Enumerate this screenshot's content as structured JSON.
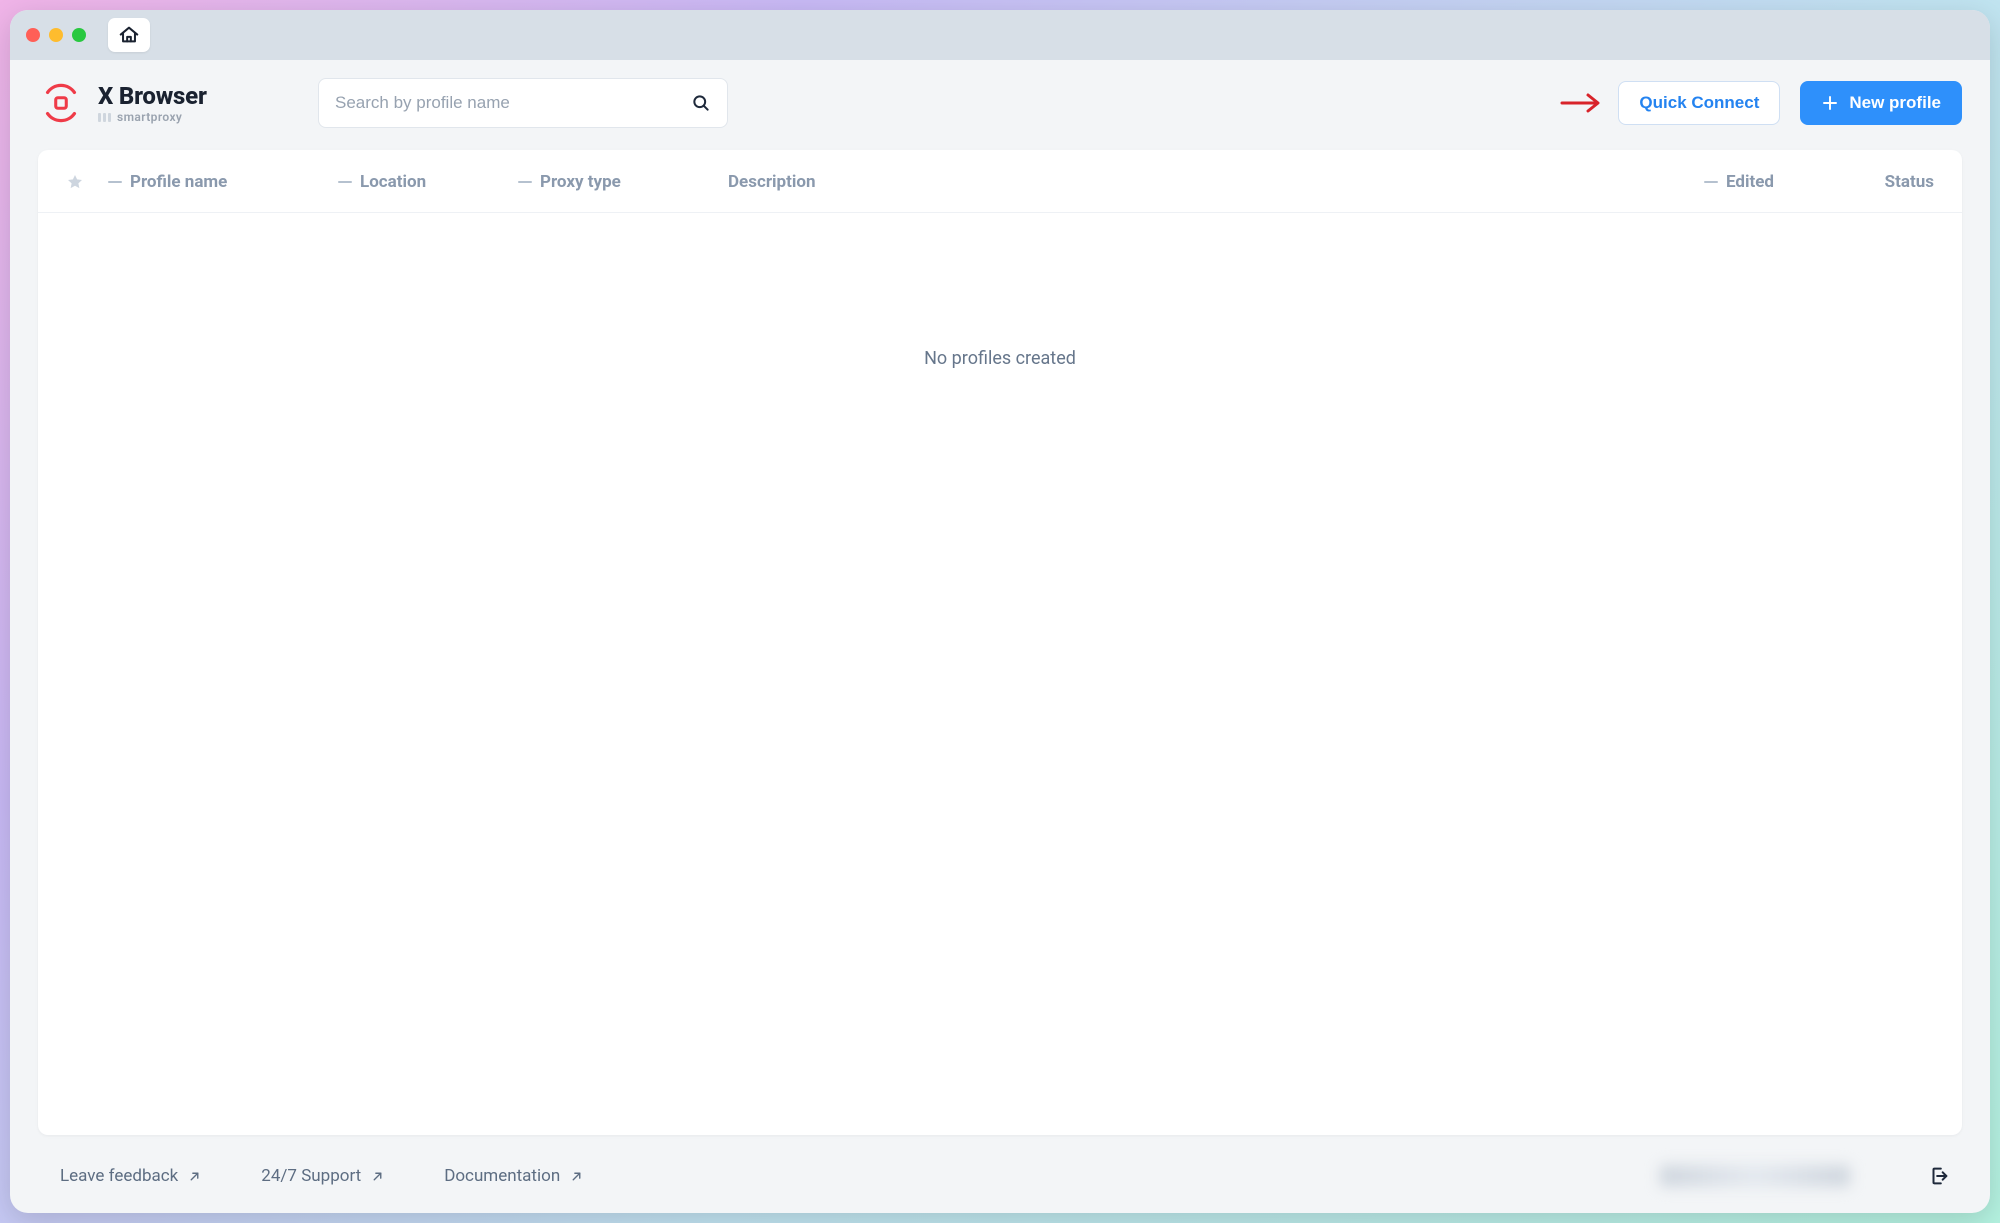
{
  "brand": {
    "title": "X Browser",
    "subtitle": "smartproxy"
  },
  "search": {
    "placeholder": "Search by profile name",
    "value": ""
  },
  "actions": {
    "quick_connect": "Quick Connect",
    "new_profile": "New profile"
  },
  "columns": {
    "profile_name": "Profile name",
    "location": "Location",
    "proxy_type": "Proxy type",
    "description": "Description",
    "edited": "Edited",
    "status": "Status"
  },
  "table": {
    "rows": [],
    "empty_message": "No profiles created"
  },
  "footer": {
    "feedback": "Leave feedback",
    "support": "24/7 Support",
    "docs": "Documentation"
  }
}
